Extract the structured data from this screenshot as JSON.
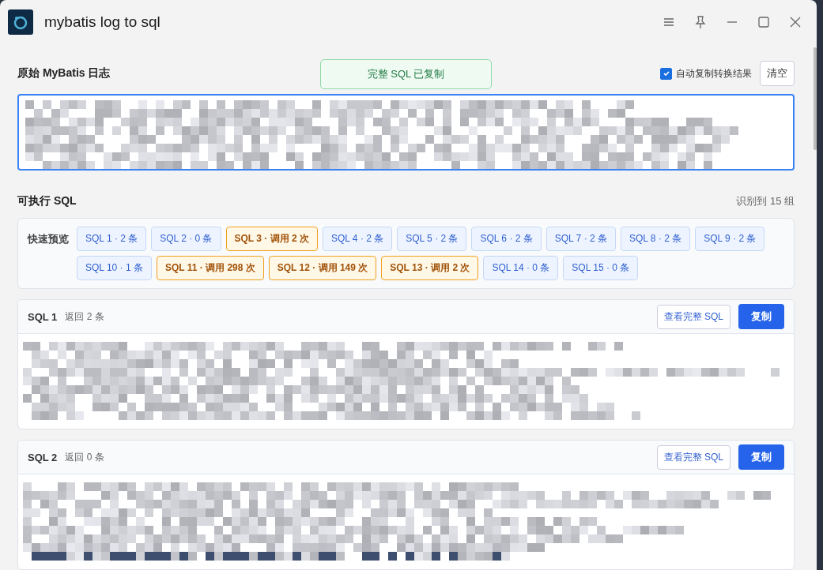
{
  "window": {
    "title": "mybatis log to sql"
  },
  "toast": {
    "text": "完整 SQL 已复制"
  },
  "log_section": {
    "title": "原始 MyBatis 日志",
    "auto_copy": {
      "label": "自动复制转换结果",
      "checked": true
    },
    "clear_button": "清空"
  },
  "sql_section": {
    "title": "可执行 SQL",
    "summary": "识别到 15 组"
  },
  "quick_preview": {
    "label": "快速预览",
    "chips": [
      {
        "text": "SQL 1 · 2 条",
        "kind": "rows"
      },
      {
        "text": "SQL 2 · 0 条",
        "kind": "rows"
      },
      {
        "text": "SQL 3 · 调用 2 次",
        "kind": "calls"
      },
      {
        "text": "SQL 4 · 2 条",
        "kind": "rows"
      },
      {
        "text": "SQL 5 · 2 条",
        "kind": "rows"
      },
      {
        "text": "SQL 6 · 2 条",
        "kind": "rows"
      },
      {
        "text": "SQL 7 · 2 条",
        "kind": "rows"
      },
      {
        "text": "SQL 8 · 2 条",
        "kind": "rows"
      },
      {
        "text": "SQL 9 · 2 条",
        "kind": "rows"
      },
      {
        "text": "SQL 10 · 1 条",
        "kind": "rows"
      },
      {
        "text": "SQL 11 · 调用 298 次",
        "kind": "calls"
      },
      {
        "text": "SQL 12 · 调用 149 次",
        "kind": "calls"
      },
      {
        "text": "SQL 13 · 调用 2 次",
        "kind": "calls"
      },
      {
        "text": "SQL 14 · 0 条",
        "kind": "rows"
      },
      {
        "text": "SQL 15 · 0 条",
        "kind": "rows"
      }
    ]
  },
  "sql_cards": [
    {
      "title": "SQL 1",
      "result": "返回 2 条",
      "view_button": "查看完整 SQL",
      "copy_button": "复制"
    },
    {
      "title": "SQL 2",
      "result": "返回 0 条",
      "view_button": "查看完整 SQL",
      "copy_button": "复制"
    }
  ]
}
